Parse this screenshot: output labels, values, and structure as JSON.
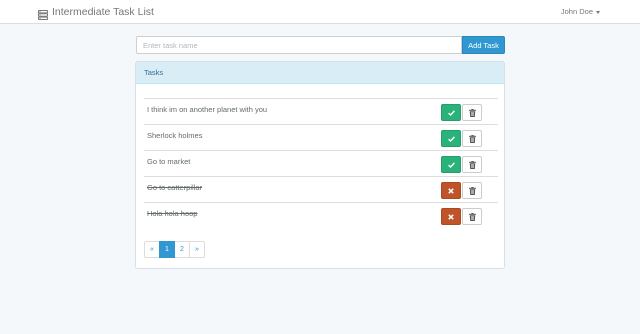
{
  "navbar": {
    "brand_icon": "server-stack-icon",
    "brand_title": "Intermediate Task List",
    "user_name": "John Doe",
    "user_caret_icon": "caret-down-icon"
  },
  "task_form": {
    "placeholder": "Enter task name",
    "value": "",
    "add_button_label": "Add Task"
  },
  "panel": {
    "heading": "Tasks"
  },
  "tasks": [
    {
      "name": "I think im on another planet with you",
      "completed": false,
      "status_icon": "check-icon",
      "delete_icon": "trash-icon"
    },
    {
      "name": "Sherlock holmes",
      "completed": false,
      "status_icon": "check-icon",
      "delete_icon": "trash-icon"
    },
    {
      "name": "Go to market",
      "completed": false,
      "status_icon": "check-icon",
      "delete_icon": "trash-icon"
    },
    {
      "name": "Go to catterpillar",
      "completed": true,
      "status_icon": "x-icon",
      "delete_icon": "trash-icon"
    },
    {
      "name": "Hola hola hoop",
      "completed": true,
      "status_icon": "x-icon",
      "delete_icon": "trash-icon"
    }
  ],
  "pagination": {
    "prev_label": "«",
    "pages": [
      "1",
      "2"
    ],
    "current_page": "1",
    "next_label": "»"
  },
  "colors": {
    "background": "#f5f8fa",
    "primary": "#3097d1",
    "success": "#2ab27b",
    "danger": "#bf5329",
    "panel_heading_bg": "#d9edf7",
    "panel_heading_text": "#31708f"
  }
}
